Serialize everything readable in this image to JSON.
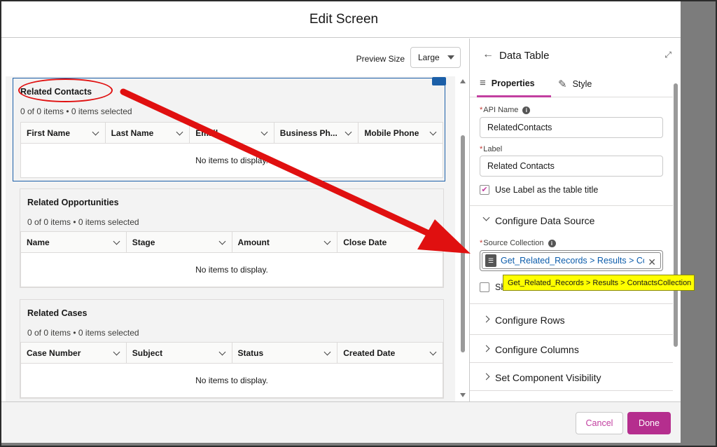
{
  "modal": {
    "title": "Edit Screen"
  },
  "preview": {
    "label": "Preview Size",
    "value": "Large"
  },
  "tables": [
    {
      "title": "Related Contacts",
      "count": "0 of 0 items • 0 items selected",
      "columns": [
        "First Name",
        "Last Name",
        "Email",
        "Business Ph...",
        "Mobile Phone"
      ],
      "empty": "No items to display."
    },
    {
      "title": "Related Opportunities",
      "count": "0 of 0 items • 0 items selected",
      "columns": [
        "Name",
        "Stage",
        "Amount",
        "Close Date"
      ],
      "empty": "No items to display."
    },
    {
      "title": "Related Cases",
      "count": "0 of 0 items • 0 items selected",
      "columns": [
        "Case Number",
        "Subject",
        "Status",
        "Created Date"
      ],
      "empty": "No items to display."
    }
  ],
  "props": {
    "title": "Data Table",
    "tabs": {
      "properties": "Properties",
      "style": "Style"
    },
    "api_name": {
      "label": "API Name",
      "value": "RelatedContacts"
    },
    "label_field": {
      "label": "Label",
      "value": "Related Contacts"
    },
    "use_label_checkbox": {
      "label": "Use Label as the table title",
      "checked": true
    },
    "sections": {
      "data_source": "Configure Data Source",
      "rows": "Configure Rows",
      "columns": "Configure Columns",
      "visibility": "Set Component Visibility"
    },
    "source_collection": {
      "label": "Source Collection",
      "value": "Get_Related_Records > Results > Co...",
      "tooltip": "Get_Related_Records > Results > ContactsCollection"
    },
    "show_checkbox_label": "Sh"
  },
  "footer": {
    "cancel": "Cancel",
    "done": "Done"
  },
  "colors": {
    "brand": "#b52e8e",
    "selection": "#1b5fa8",
    "annotation": "#e01010",
    "tooltip": "#ffff00"
  }
}
